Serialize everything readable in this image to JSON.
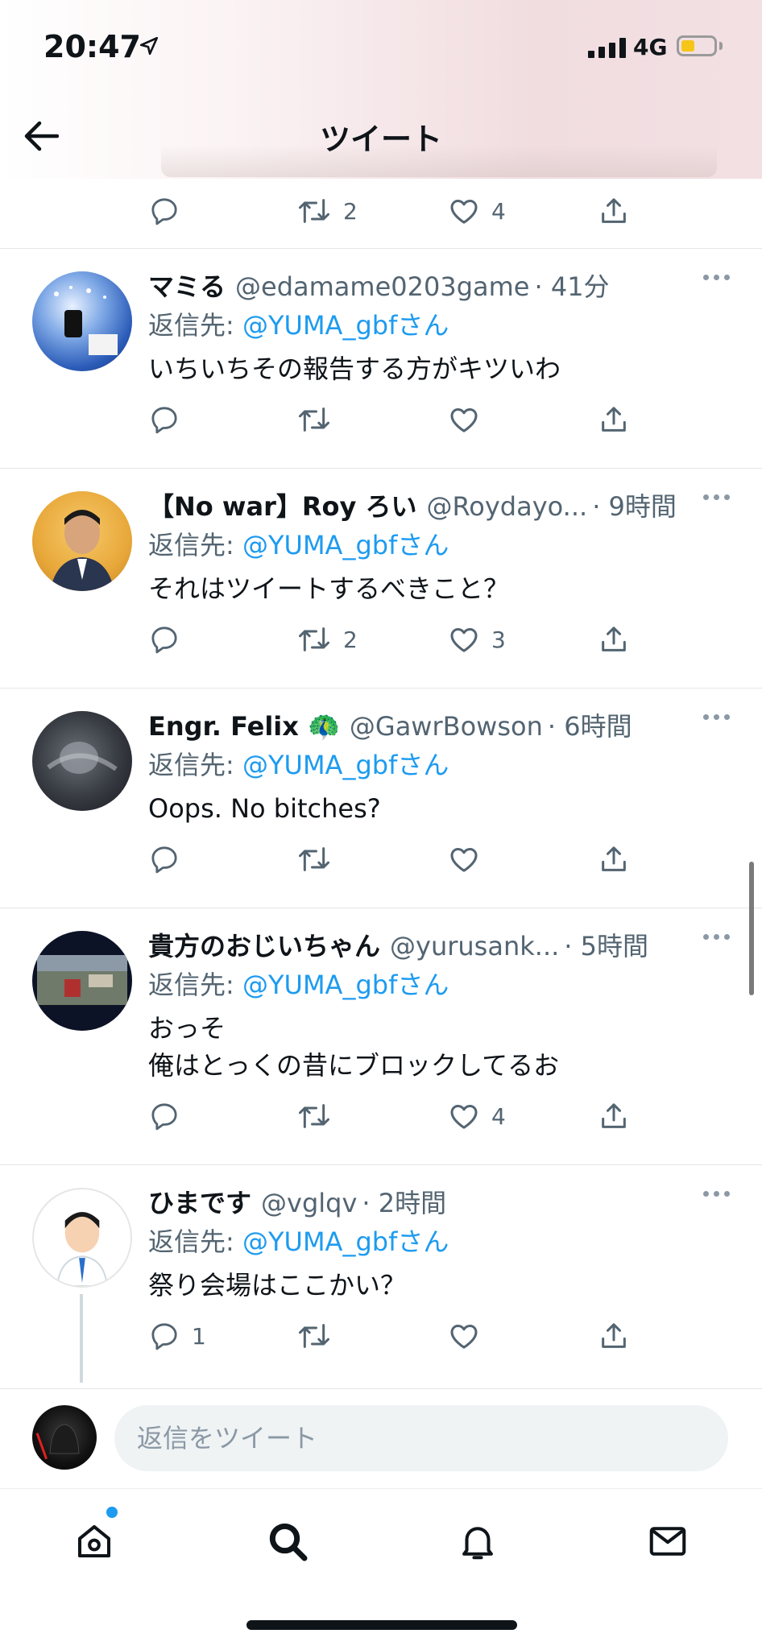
{
  "status_bar": {
    "time": "20:47",
    "network": "4G",
    "location_icon": "location-arrow-icon",
    "signal_icon": "cellular-signal-icon",
    "battery_icon": "battery-low-icon",
    "battery_color": "#f5c518"
  },
  "header": {
    "title": "ツイート",
    "back_icon": "back-arrow-icon"
  },
  "top_actions": {
    "reply_count": "",
    "retweet_count": "2",
    "like_count": "4"
  },
  "colors": {
    "link": "#1d9bf0",
    "secondary_text": "#536471",
    "divider": "#e6e6e6",
    "notification_dot": "#1d9bf0"
  },
  "reply_prefix": "返信先:",
  "tweets": [
    {
      "name": "マミる",
      "handle": "@edamame0203game",
      "time": "· 41分",
      "reply_to": "@YUMA_gbfさん",
      "text": "いちいちその報告する方がキツいわ",
      "reply_count": "",
      "retweet_count": "",
      "like_count": ""
    },
    {
      "name": "【No war】Roy ろい",
      "handle": "@Roydayo...",
      "time": "· 9時間",
      "reply_to": "@YUMA_gbfさん",
      "text": "それはツイートするべきこと？",
      "reply_count": "",
      "retweet_count": "2",
      "like_count": "3"
    },
    {
      "name": "Engr. Felix 🦚",
      "handle": "@GawrBowson",
      "time": "· 6時間",
      "reply_to": "@YUMA_gbfさん",
      "text": "Oops. No bitches?",
      "reply_count": "",
      "retweet_count": "",
      "like_count": ""
    },
    {
      "name": "貴方のおじいちゃん",
      "handle": "@yurusank...",
      "time": "· 5時間",
      "reply_to": "@YUMA_gbfさん",
      "text_line1": "おっそ",
      "text_line2": "俺はとっくの昔にブロックしてるお",
      "reply_count": "",
      "retweet_count": "",
      "like_count": "4"
    },
    {
      "name": "ひまです",
      "handle": "@vglqv",
      "time": "· 2時間",
      "reply_to": "@YUMA_gbfさん",
      "text": "祭り会場はここかい？",
      "reply_count": "1",
      "retweet_count": "",
      "like_count": ""
    }
  ],
  "composer": {
    "placeholder": "返信をツイート"
  },
  "tab_bar": {
    "items": [
      "home-icon",
      "search-icon",
      "notifications-bell-icon",
      "messages-envelope-icon"
    ]
  }
}
